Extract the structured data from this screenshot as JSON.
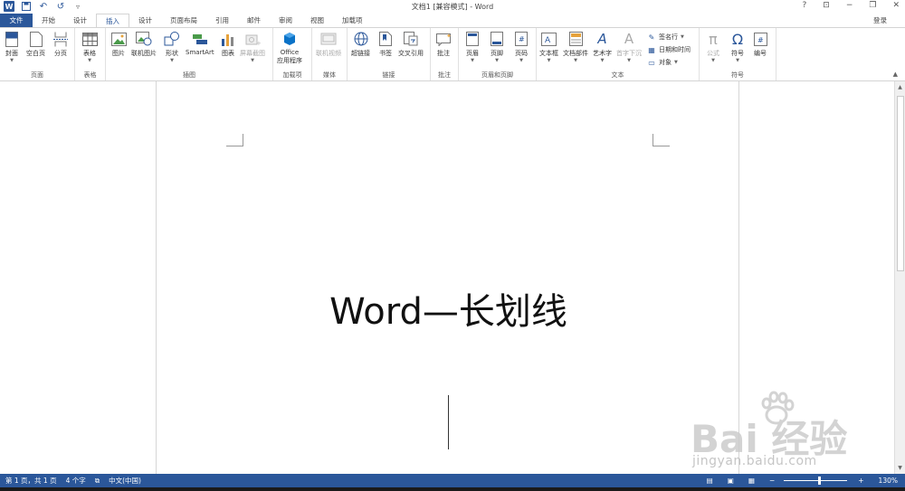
{
  "window": {
    "title": "文档1 [兼容模式] - Word",
    "help": "?",
    "minimize": "−",
    "restore": "❐",
    "close": "✕",
    "ribbon_display": "⊡"
  },
  "qat": {
    "undo": "↶",
    "redo": "↺",
    "customize": "▿"
  },
  "tabs": [
    "文件",
    "开始",
    "设计",
    "插入",
    "设计",
    "页面布局",
    "引用",
    "邮件",
    "审阅",
    "视图",
    "加载项"
  ],
  "login": "登录",
  "ribbon": {
    "pages": {
      "label": "页面",
      "cover": "封面",
      "blank": "空白页",
      "break": "分页"
    },
    "tables": {
      "label": "表格",
      "table": "表格"
    },
    "illustrations": {
      "label": "插图",
      "picture": "图片",
      "online_picture": "联机图片",
      "shapes": "形状",
      "smartart": "SmartArt",
      "chart": "图表",
      "screenshot": "屏幕截图"
    },
    "addins": {
      "label": "加载项",
      "office_line1": "Office",
      "office_line2": "应用程序"
    },
    "media": {
      "label": "媒体",
      "online_video": "联机视频"
    },
    "links": {
      "label": "链接",
      "hyperlink": "超链接",
      "bookmark": "书签",
      "crossref": "交叉引用"
    },
    "comments": {
      "label": "批注",
      "comment": "批注"
    },
    "header_footer": {
      "label": "页眉和页脚",
      "header": "页眉",
      "footer": "页脚",
      "page_number": "页码"
    },
    "text": {
      "label": "文本",
      "textbox": "文本框",
      "quickparts": "文档部件",
      "wordart": "艺术字",
      "dropcap": "首字下沉",
      "signature": "签名行",
      "datetime": "日期和时间",
      "object": "对象"
    },
    "symbols": {
      "label": "符号",
      "equation": "公式",
      "symbol": "符号",
      "number": "编号"
    }
  },
  "document": {
    "heading": "Word—长划线"
  },
  "status": {
    "page": "第 1 页，共 1 页",
    "words": "4 个字",
    "language": "中文(中国)",
    "zoom": "130%"
  },
  "watermark": {
    "brand": "Bai  经验",
    "url": "jingyan.baidu.com"
  },
  "colors": {
    "accent": "#2b579a"
  }
}
